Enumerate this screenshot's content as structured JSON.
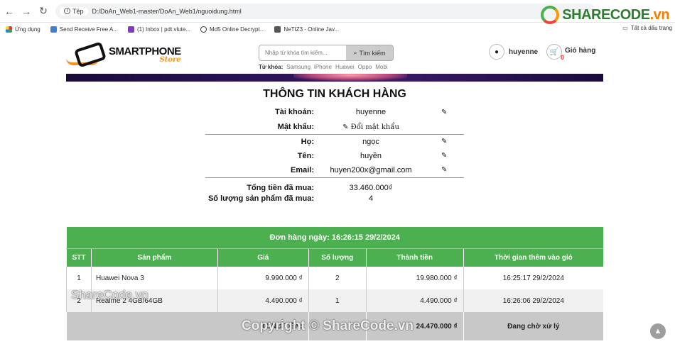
{
  "browser": {
    "file_chip": "Tệp",
    "url": "D:/DoAn_Web1-master/DoAn_Web1/nguoidung.html",
    "bookmarks": [
      "Ứng dụng",
      "Send Receive Free A...",
      "(1) Inbox | pdt.vlute...",
      "Md5 Online Decrypt...",
      "NeTIZ3 - Online Jav..."
    ],
    "all_bookmarks": "Tất cả dấu trang",
    "sharecode_logo": "SHARECODE",
    "sharecode_logo_suffix": ".vn"
  },
  "site": {
    "logo_line1": "SMARTPHONE",
    "logo_line2": "Store",
    "search_placeholder": "Nhập từ khóa tìm kiếm...",
    "search_button": "Tìm kiếm",
    "keywords_label": "Từ khóa:",
    "keywords": [
      "Samsung",
      "iPhone",
      "Huawei",
      "Oppo",
      "Mobi"
    ],
    "user_name": "huyenne",
    "cart_label": "Giỏ hàng",
    "cart_count": "0"
  },
  "customer": {
    "title": "THÔNG TIN KHÁCH HÀNG",
    "account_label": "Tài khoản:",
    "account_value": "huyenne",
    "password_label": "Mật khẩu:",
    "password_action": "Đổi mật khẩu",
    "lastname_label": "Họ:",
    "lastname_value": "ngọc",
    "firstname_label": "Tên:",
    "firstname_value": "huyền",
    "email_label": "Email:",
    "email_value": "huyen200x@gmail.com",
    "total_spent_label": "Tổng tiền đã mua:",
    "total_spent_value": "33.460.000₫",
    "product_count_label": "Số lượng sản phẩm đã mua:",
    "product_count_value": "4"
  },
  "order": {
    "title": "Đơn hàng ngày: 16:26:15 29/2/2024",
    "columns": [
      "STT",
      "Sản phẩm",
      "Giá",
      "Số lượng",
      "Thành tiền",
      "Thời gian thêm vào giỏ"
    ],
    "rows": [
      {
        "stt": "1",
        "product": "Huawei Nova 3",
        "price": "9.990.000 ₫",
        "qty": "2",
        "subtotal": "19.980.000 ₫",
        "added": "16:25:17 29/2/2024"
      },
      {
        "stt": "2",
        "product": "Realme 2 4GB/64GB",
        "price": "4.490.000 ₫",
        "qty": "1",
        "subtotal": "4.490.000 ₫",
        "added": "16:26:06 29/2/2024"
      }
    ],
    "total_label": "TỔNG TIỀN:",
    "total_value": "24.470.000 ₫",
    "status": "Đang chờ xử lý"
  },
  "watermarks": {
    "top": "ShareCode.vn",
    "bottom": "Copyright © ShareCode.vn"
  },
  "colors": {
    "accent_green": "#4caf50",
    "logo_orange": "#f7941d"
  }
}
